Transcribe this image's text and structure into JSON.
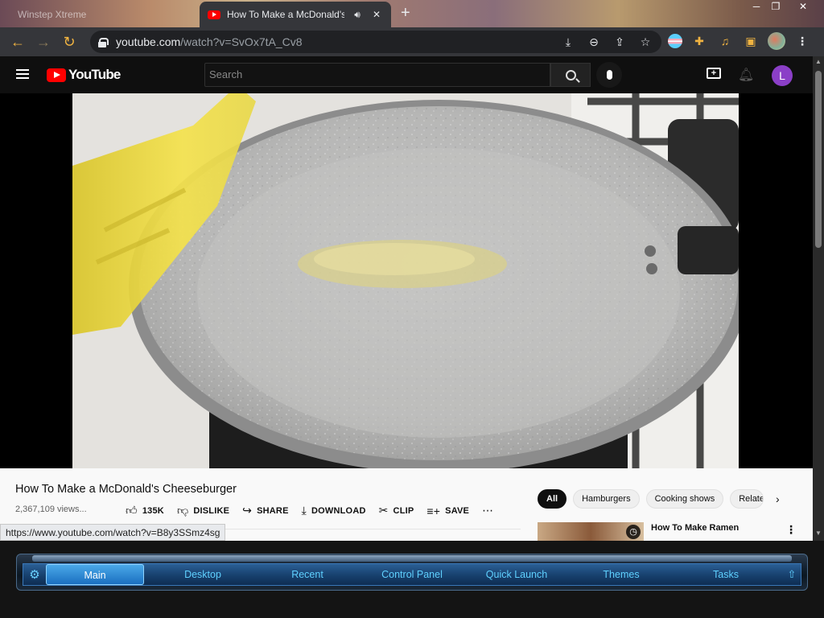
{
  "browser": {
    "tabs": [
      {
        "label": "Winstep Xtreme",
        "active": false
      },
      {
        "label": "How To Make a McDonald's",
        "active": true
      }
    ],
    "url_host": "youtube.com",
    "url_path": "/watch?v=SvOx7tA_Cv8",
    "status_url": "https://www.youtube.com/watch?v=B8y3SSmz4sg",
    "profile_initial": ""
  },
  "youtube": {
    "logo_text": "YouTube",
    "search_placeholder": "Search",
    "avatar_initial": "L",
    "video": {
      "title": "How To Make a McDonald's Cheeseburger",
      "views": "2,367,109 views...",
      "actions": {
        "like": "135K",
        "dislike": "DISLIKE",
        "share": "SHARE",
        "download": "DOWNLOAD",
        "clip": "CLIP",
        "save": "SAVE"
      }
    },
    "chips": [
      "All",
      "Hamburgers",
      "Cooking shows",
      "Related"
    ],
    "recommendation": {
      "title": "How To Make Ramen"
    }
  },
  "taskbar": {
    "items": [
      "Main",
      "Desktop",
      "Recent",
      "Control Panel",
      "Quick Launch",
      "Themes",
      "Tasks"
    ]
  },
  "colors": {
    "yt_red": "#ff0000",
    "accent_amber": "#f0b341",
    "taskbar_text": "#5fd0ff",
    "avatar_purple": "#8b3fc7"
  }
}
